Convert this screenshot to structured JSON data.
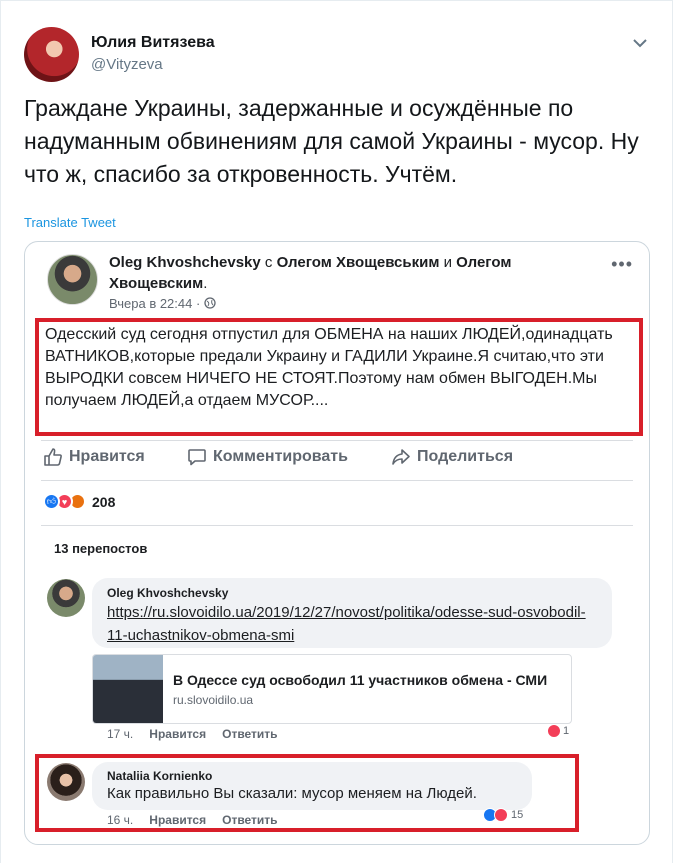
{
  "tweet": {
    "author_name": "Юлия Витязева",
    "author_handle": "@Vityzeva",
    "text": "Граждане Украины, задержанные и осуждённые по надуманным обвинениям для самой Украины - мусор. Ну что ж, спасибо за откровенность. Учтём.",
    "translate_label": "Translate Tweet",
    "caret_icon": "chevron-down-icon"
  },
  "fb_post": {
    "author": "Oleg Khvoshchevsky",
    "with_text": " с ",
    "tag1": "Олегом Хвощевським",
    "and_text": " и ",
    "tag2": "Олегом Хвощевским",
    "period": ".",
    "time": "Вчера в 22:44 · ",
    "body": "Одесский суд сегодня отпустил для ОБМЕНА на наших ЛЮДЕЙ,одинадцать ВАТНИКОВ,которые предали Украину и ГАДИЛИ Украине.Я считаю,что эти ВЫРОДКИ совсем НИЧЕГО НЕ СТОЯТ.Поэтому нам обмен ВЫГОДЕН.Мы получаем ЛЮДЕЙ,а отдаем МУСОР....",
    "actions": {
      "like": "Нравится",
      "comment": "Комментировать",
      "share": "Поделиться"
    },
    "reactions_count": "208",
    "shares_label": "13 перепостов",
    "colors": {
      "highlight": "#d81f2a",
      "like_blue": "#1877f2",
      "love_red": "#f33e58",
      "angry_orange": "#f7b125"
    }
  },
  "comments": [
    {
      "author": "Oleg Khvoshchevsky",
      "link": "https://ru.slovoidilo.ua/2019/12/27/novost/politika/odesse-sud-osvobodil-11-uchastnikov-obmena-smi",
      "preview_title": "В Одессе суд освободил 11 участников обмена - СМИ",
      "preview_domain": "ru.slovoidilo.ua",
      "time": "17 ч.",
      "like": "Нравится",
      "reply": "Ответить",
      "reactions": "1"
    },
    {
      "author": "Nataliia Kornienko",
      "text": "Как правильно Вы сказали: мусор меняем на Людей.",
      "time": "16 ч.",
      "like": "Нравится",
      "reply": "Ответить",
      "reactions": "15"
    }
  ]
}
